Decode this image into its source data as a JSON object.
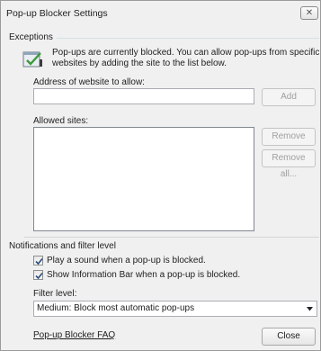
{
  "window": {
    "title": "Pop-up Blocker Settings"
  },
  "exceptions": {
    "group_label": "Exceptions",
    "info_line1": "Pop-ups are currently blocked.  You can allow pop-ups from specific",
    "info_line2": "websites by adding the site to the list below.",
    "address_label": "Address of website to allow:",
    "address_value": "",
    "add_label": "Add",
    "allowed_label": "Allowed sites:",
    "allowed_sites": [],
    "remove_label": "Remove",
    "remove_all_label": "Remove all..."
  },
  "notifications": {
    "group_label": "Notifications and filter level",
    "play_sound_label": "Play a sound when a pop-up is blocked.",
    "play_sound_checked": true,
    "info_bar_label": "Show Information Bar when a pop-up is blocked.",
    "info_bar_checked": true,
    "filter_label": "Filter level:",
    "filter_value": "Medium: Block most automatic pop-ups"
  },
  "footer": {
    "faq_link": "Pop-up Blocker FAQ",
    "close_label": "Close"
  },
  "icons": {
    "close": "close-icon",
    "info": "popup-blocker-icon",
    "dropdown": "chevron-down-icon",
    "check": "check-icon"
  }
}
